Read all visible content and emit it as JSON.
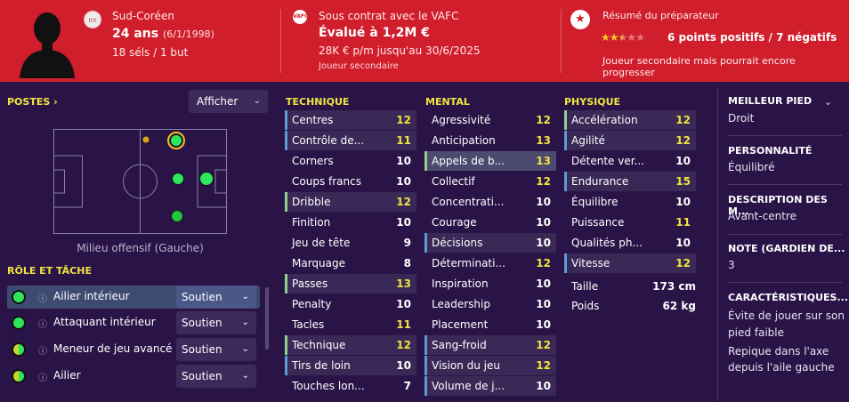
{
  "header": {
    "nationality": "Sud-Coréen",
    "flag_text": "Int",
    "age": "24 ans",
    "dob": "(6/1/1998)",
    "caps": "18 séls / 1 but",
    "club_badge": "VAFC",
    "contract": "Sous contrat avec le VAFC",
    "value": "Évalué à 1,2M €",
    "wage": "28K € p/m jusqu'au 30/6/2025",
    "squad_role": "Joueur secondaire",
    "coach_title": "Résumé du préparateur",
    "stars": 2.5,
    "points": "6 points positifs / 7 négatifs",
    "coach_note": "Joueur secondaire mais pourrait encore progresser"
  },
  "positions": {
    "title": "POSTES",
    "title_chevron": "›",
    "show_label": "Afficher",
    "pitch_label": "Milieu offensif (Gauche)"
  },
  "roles": {
    "title": "RÔLE ET TÂCHE",
    "info_icon": "ⓘ",
    "items": [
      {
        "name": "Ailier intérieur",
        "duty": "Soutien"
      },
      {
        "name": "Attaquant intérieur",
        "duty": "Soutien"
      },
      {
        "name": "Meneur de jeu avancé",
        "duty": "Soutien"
      },
      {
        "name": "Ailier",
        "duty": "Soutien"
      }
    ]
  },
  "technique": {
    "title": "TECHNIQUE",
    "attrs": [
      {
        "name": "Centres",
        "value": "12"
      },
      {
        "name": "Contrôle de...",
        "value": "11"
      },
      {
        "name": "Corners",
        "value": "10"
      },
      {
        "name": "Coups francs",
        "value": "10"
      },
      {
        "name": "Dribble",
        "value": "12"
      },
      {
        "name": "Finition",
        "value": "10"
      },
      {
        "name": "Jeu de tête",
        "value": "9"
      },
      {
        "name": "Marquage",
        "value": "8"
      },
      {
        "name": "Passes",
        "value": "13"
      },
      {
        "name": "Penalty",
        "value": "10"
      },
      {
        "name": "Tacles",
        "value": "11"
      },
      {
        "name": "Technique",
        "value": "12"
      },
      {
        "name": "Tirs de loin",
        "value": "10"
      },
      {
        "name": "Touches lon...",
        "value": "7"
      }
    ]
  },
  "mental": {
    "title": "MENTAL",
    "attrs": [
      {
        "name": "Agressivité",
        "value": "12"
      },
      {
        "name": "Anticipation",
        "value": "13"
      },
      {
        "name": "Appels de b...",
        "value": "13"
      },
      {
        "name": "Collectif",
        "value": "12"
      },
      {
        "name": "Concentrati...",
        "value": "10"
      },
      {
        "name": "Courage",
        "value": "10"
      },
      {
        "name": "Décisions",
        "value": "10"
      },
      {
        "name": "Déterminati...",
        "value": "12"
      },
      {
        "name": "Inspiration",
        "value": "10"
      },
      {
        "name": "Leadership",
        "value": "10"
      },
      {
        "name": "Placement",
        "value": "10"
      },
      {
        "name": "Sang-froid",
        "value": "12"
      },
      {
        "name": "Vision du jeu",
        "value": "12"
      },
      {
        "name": "Volume de j...",
        "value": "10"
      }
    ]
  },
  "physique": {
    "title": "PHYSIQUE",
    "attrs": [
      {
        "name": "Accélération",
        "value": "12"
      },
      {
        "name": "Agilité",
        "value": "12"
      },
      {
        "name": "Détente ver...",
        "value": "10"
      },
      {
        "name": "Endurance",
        "value": "15"
      },
      {
        "name": "Équilibre",
        "value": "10"
      },
      {
        "name": "Puissance",
        "value": "11"
      },
      {
        "name": "Qualités ph...",
        "value": "10"
      },
      {
        "name": "Vitesse",
        "value": "12"
      }
    ],
    "height_label": "Taille",
    "height": "173 cm",
    "weight_label": "Poids",
    "weight": "62 kg"
  },
  "side": {
    "foot_title": "MEILLEUR PIED",
    "foot": "Droit",
    "personality_title": "PERSONNALITÉ",
    "personality": "Équilibré",
    "desc_title": "DESCRIPTION DES M...",
    "desc": "Avant-centre",
    "note_title": "NOTE (GARDIEN DE...",
    "note": "3",
    "traits_title": "CARACTÉRISTIQUES...",
    "trait1_line1": "Évite de jouer sur son",
    "trait1_line2": "pied faible",
    "trait2_line1": "Repique dans l'axe",
    "trait2_line2": "depuis l'aile gauche"
  },
  "colors": {
    "header_red": "#d01e2c",
    "background": "#2a1447",
    "accent_yellow": "#f0e441",
    "natural_green": "#2ee65c",
    "accomplished_green": "#22c53e",
    "alternate_orange": "#e0a020"
  }
}
